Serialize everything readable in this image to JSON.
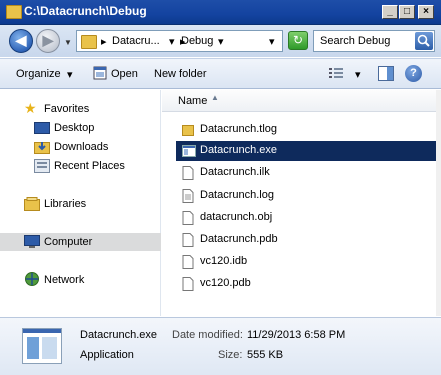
{
  "window": {
    "title": "C:\\Datacrunch\\Debug",
    "minimize": "_",
    "maximize": "□",
    "close": "×"
  },
  "address": {
    "back": "◀",
    "forward": "▶",
    "history": "▼",
    "sep1": "▸",
    "crumb1": "Datacru...",
    "crumb1_arrow": "▾",
    "sep2": "▸",
    "crumb2": "Debug",
    "crumb2_arrow": "▾",
    "dropdown": "▾",
    "refresh": "↻",
    "search_placeholder": "Search Debug"
  },
  "toolbar": {
    "organize": "Organize",
    "organize_arrow": "▾",
    "open": "Open",
    "new_folder": "New folder",
    "views_arrow": "▾",
    "help": "?"
  },
  "nav": {
    "favorites": "Favorites",
    "desktop": "Desktop",
    "downloads": "Downloads",
    "recent": "Recent Places",
    "libraries": "Libraries",
    "computer": "Computer",
    "network": "Network"
  },
  "content": {
    "column_name": "Name",
    "sort_indicator": "▲",
    "files": [
      {
        "name": "Datacrunch.tlog",
        "type": "folder"
      },
      {
        "name": "Datacrunch.exe",
        "type": "exe"
      },
      {
        "name": "Datacrunch.ilk",
        "type": "file"
      },
      {
        "name": "Datacrunch.log",
        "type": "doc"
      },
      {
        "name": "datacrunch.obj",
        "type": "file"
      },
      {
        "name": "Datacrunch.pdb",
        "type": "file"
      },
      {
        "name": "vc120.idb",
        "type": "file"
      },
      {
        "name": "vc120.pdb",
        "type": "file"
      }
    ]
  },
  "details": {
    "name": "Datacrunch.exe",
    "type": "Application",
    "date_label": "Date modified:",
    "date_value": "11/29/2013 6:58 PM",
    "size_label": "Size:",
    "size_value": "555 KB"
  },
  "colors": {
    "titlebar": "#1443a0",
    "selection": "#0e2a5c",
    "nav_selected": "#dadbdc"
  }
}
